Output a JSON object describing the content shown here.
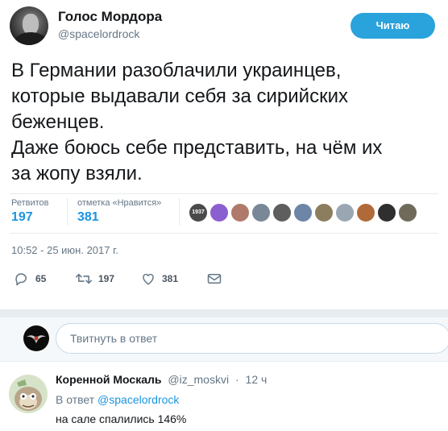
{
  "author": {
    "display_name": "Голос Мордора",
    "handle": "@spacelordrock"
  },
  "follow_button": {
    "label": "Читаю",
    "color": "#2aa3dc"
  },
  "tweet": {
    "lines": [
      "В Германии разоблачили украинцев,",
      "которые выдавали себя за сирийских",
      "беженцев.",
      "Даже боюсь себе представить, на чём их",
      "за жопу взяли."
    ]
  },
  "stats": {
    "retweets_label": "Ретвитов",
    "retweets_count": "197",
    "likes_label": "отметка «Нравится»",
    "likes_count": "381"
  },
  "liker_avatars": [
    {
      "name": "liker-avatar-1",
      "color": "#4a4a4a",
      "text": "1937"
    },
    {
      "name": "liker-avatar-2",
      "color": "#8b5fd0"
    },
    {
      "name": "liker-avatar-3",
      "color": "#b07a6a"
    },
    {
      "name": "liker-avatar-4",
      "color": "#7a8796"
    },
    {
      "name": "liker-avatar-5",
      "color": "#5e5e5e"
    },
    {
      "name": "liker-avatar-6",
      "color": "#6d86a8"
    },
    {
      "name": "liker-avatar-7",
      "color": "#8c7d5e"
    },
    {
      "name": "liker-avatar-8",
      "color": "#9aa7b3"
    },
    {
      "name": "liker-avatar-9",
      "color": "#b06a3a"
    },
    {
      "name": "liker-avatar-10",
      "color": "#2f2f2f"
    },
    {
      "name": "liker-avatar-11",
      "color": "#6f6a5a"
    }
  ],
  "timestamp": "10:52 - 25 июн. 2017 г.",
  "actions": {
    "replies": "65",
    "retweets": "197",
    "likes": "381"
  },
  "reply_box": {
    "placeholder": "Твитнуть в ответ"
  },
  "reply": {
    "name": "Коренной Москаль",
    "handle": "@iz_moskvi",
    "dot": "·",
    "time": "12 ч",
    "in_reply_prefix": "В ответ",
    "in_reply_mention": "@spacelordrock",
    "text": "на сале спалились 146%"
  },
  "colors": {
    "accent": "#1b95e0",
    "secondary_text": "#657786",
    "divider": "#e6ecf0"
  }
}
